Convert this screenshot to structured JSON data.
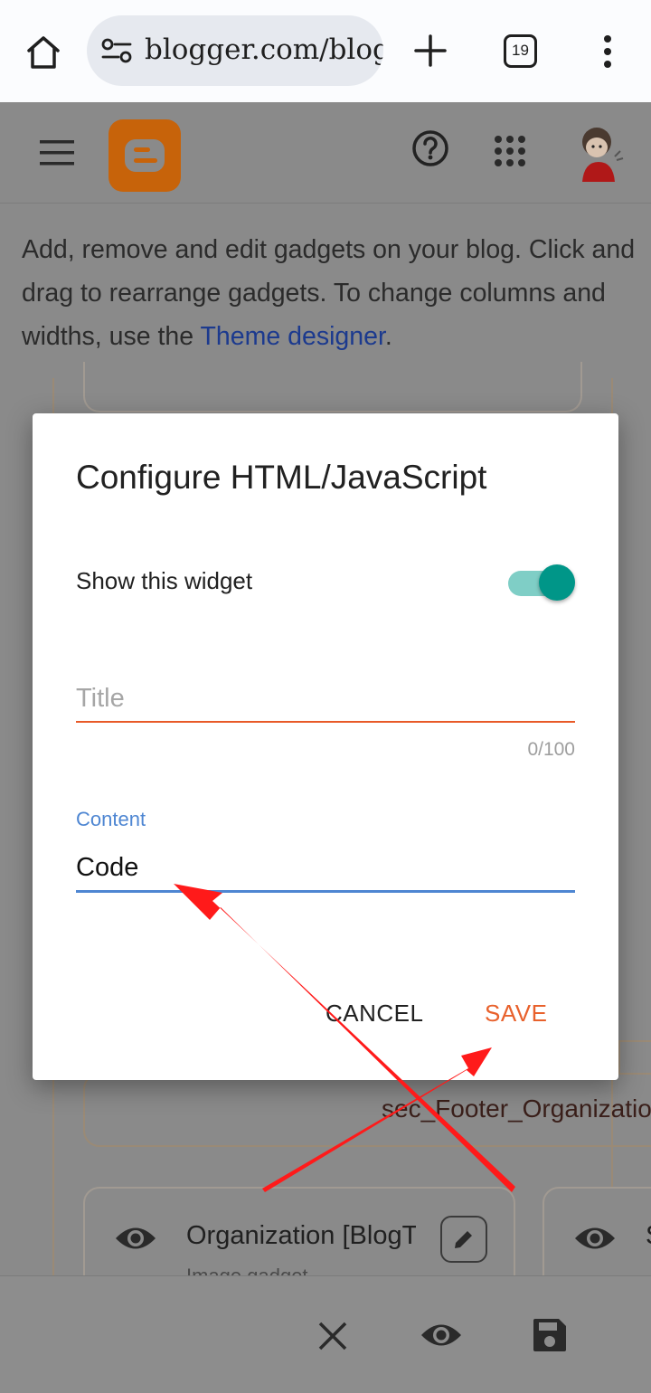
{
  "browser": {
    "url": "blogger.com/blog",
    "tab_count": "19",
    "icons": [
      "home-icon",
      "site-settings-icon",
      "new-tab-icon",
      "tabs-count",
      "menu-dots-icon"
    ]
  },
  "app_bar": {
    "icons": [
      "hamburger-icon",
      "blogger-logo",
      "help-icon",
      "apps-icon",
      "avatar"
    ]
  },
  "page": {
    "intro_text": "Add, remove and edit gadgets on your blog. Click and drag to rearrange gadgets. To change columns and widths, use the ",
    "intro_link": "Theme designer",
    "intro_end": "."
  },
  "layout": {
    "footer_section_label": "sec_Footer_Organization",
    "gadgets": [
      {
        "title": "Organization [BlogTitle]",
        "subtitle": "Image gadget"
      },
      {
        "title": "S",
        "subtitle": ""
      }
    ]
  },
  "bottom_toolbar": {
    "icons": [
      "close-icon",
      "preview-eye-icon",
      "save-disk-icon"
    ]
  },
  "dialog": {
    "title": "Configure HTML/JavaScript",
    "toggle_label": "Show this widget",
    "toggle_on": true,
    "title_field": {
      "value": "",
      "placeholder": "Title",
      "counter": "0/100"
    },
    "content_field": {
      "label": "Content",
      "value": "Code"
    },
    "cancel_label": "CANCEL",
    "save_label": "SAVE"
  },
  "colors": {
    "accent_orange": "#e8612c",
    "focus_blue": "#4e86d2",
    "toggle_teal": "#009688",
    "annotation_red": "#ff1a1a"
  }
}
